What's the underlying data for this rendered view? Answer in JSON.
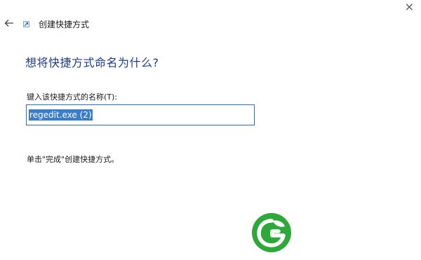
{
  "window": {
    "close_glyph": "×"
  },
  "header": {
    "back_icon": "back-arrow-icon",
    "title_icon": "shortcut-icon",
    "title": "创建快捷方式"
  },
  "main": {
    "heading": "想将快捷方式命名为什么?",
    "name_label": "键入该快捷方式的名称(T):",
    "name_value": "regedit.exe (2)",
    "hint": "单击\"完成\"创建快捷方式。"
  },
  "colors": {
    "heading": "#1e3c8c",
    "input_border": "#2c6fb5",
    "selection": "#3a7dc9",
    "logo_green": "#2fa83a"
  }
}
